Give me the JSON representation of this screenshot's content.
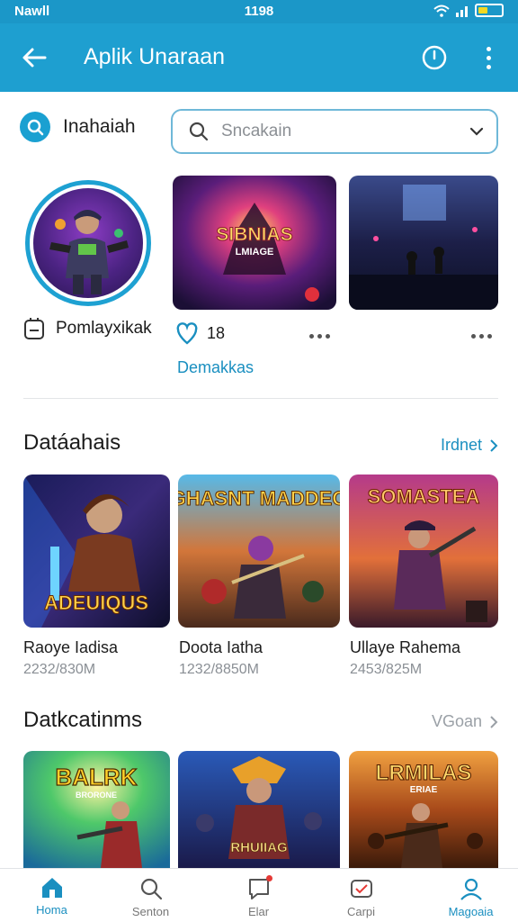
{
  "status": {
    "left": "Nawll",
    "time": "1198"
  },
  "appbar": {
    "title": "Aplik Unaraan"
  },
  "search": {
    "label": "Inahaiah",
    "placeholder": "Sncakain"
  },
  "profile": {
    "name": "Pomlayxikak"
  },
  "featured": {
    "tile1_text": "SIBNIAS",
    "tile1_sub": "LMIAGE",
    "likes": "18",
    "link": "Demakkas"
  },
  "section1": {
    "title": "Datáahais",
    "link": "Irdnet",
    "cards": [
      {
        "art_title": "ADEUIQUS",
        "title": "Raoye Iadisa",
        "meta": "2232/830M"
      },
      {
        "art_title": "GHASNT MADDEO",
        "title": "Doota Iatha",
        "meta": "1232/8850M"
      },
      {
        "art_title": "SOMASTEA",
        "title": "Ullaye Rahema",
        "meta": "2453/825M"
      }
    ]
  },
  "section2": {
    "title": "Datkcatinms",
    "link": "VGoan",
    "cards": [
      {
        "art_title": "BALRK",
        "art_sub": "BRORONE"
      },
      {
        "art_title": "RHUIIAG"
      },
      {
        "art_title": "LRMILAS",
        "art_sub": "ERIAE"
      }
    ]
  },
  "nav": [
    {
      "label": "Homa"
    },
    {
      "label": "Senton"
    },
    {
      "label": "Elar"
    },
    {
      "label": "Carpi"
    },
    {
      "label": "Magoaia"
    }
  ],
  "colors": {
    "primary": "#1e9fd0",
    "accent_text": "#1a8fc0"
  },
  "icons": [
    "back-arrow-icon",
    "history-icon",
    "more-icon",
    "search-icon",
    "chevron-down-icon",
    "badge-icon",
    "heart-icon",
    "chevron-right-icon",
    "home-icon",
    "chat-icon",
    "inbox-icon",
    "profile-icon"
  ]
}
